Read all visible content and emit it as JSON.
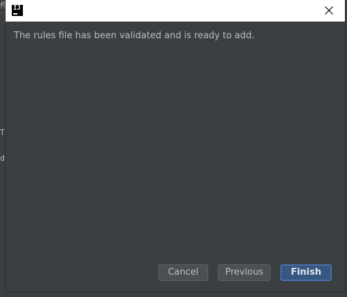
{
  "background": {
    "fragments": [
      "件",
      "Th",
      "d:"
    ]
  },
  "dialog": {
    "message": "The rules file has been validated and is ready to add.",
    "buttons": {
      "cancel": "Cancel",
      "previous": "Previous",
      "finish": "Finish"
    },
    "icons": {
      "app": "intellij-icon",
      "close": "close-icon"
    },
    "colors": {
      "background": "#3c3f41",
      "text": "#bbbbbb",
      "primary_button": "#365880",
      "primary_border": "#4b6eaf"
    }
  }
}
